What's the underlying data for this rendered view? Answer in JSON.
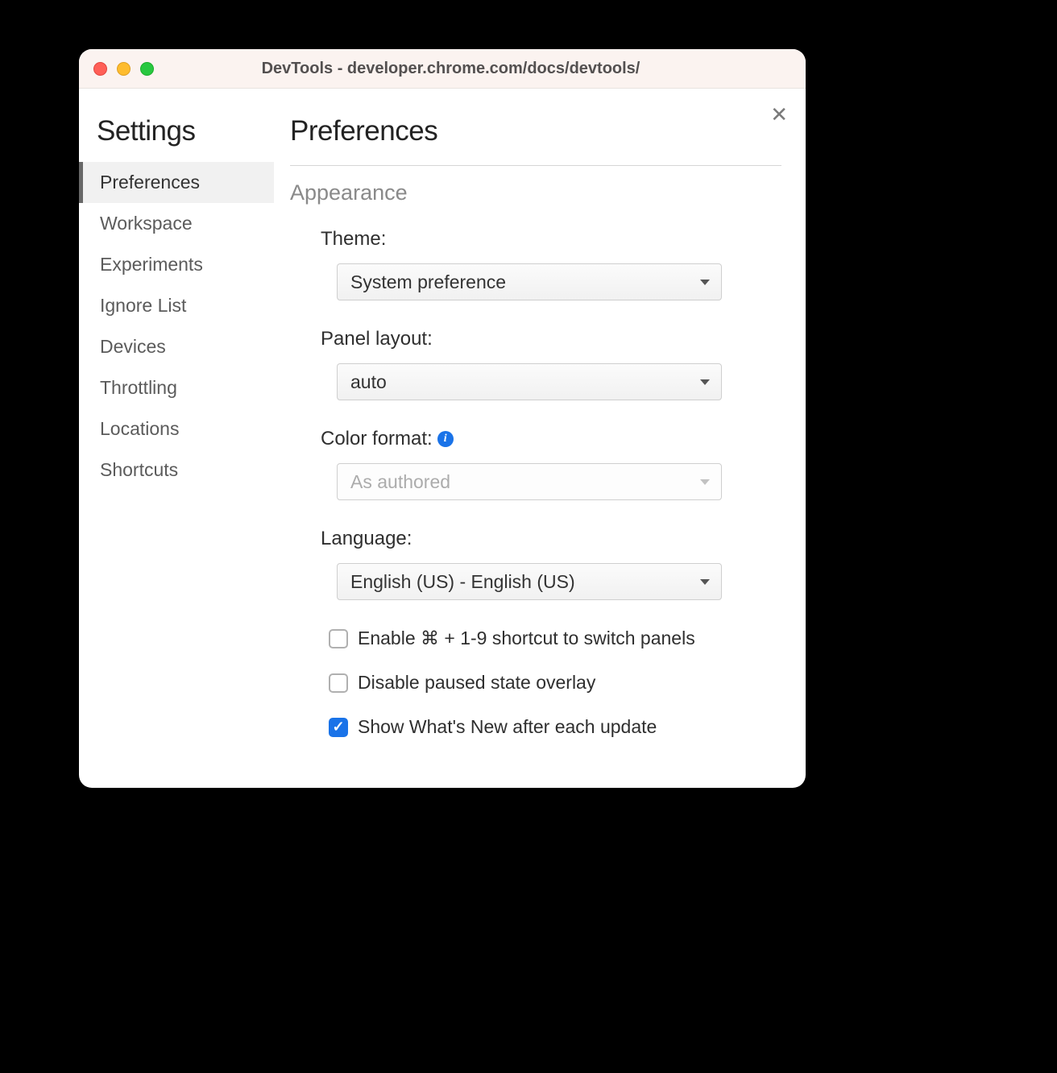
{
  "window": {
    "title": "DevTools - developer.chrome.com/docs/devtools/"
  },
  "sidebar": {
    "title": "Settings",
    "items": [
      {
        "label": "Preferences",
        "active": true
      },
      {
        "label": "Workspace",
        "active": false
      },
      {
        "label": "Experiments",
        "active": false
      },
      {
        "label": "Ignore List",
        "active": false
      },
      {
        "label": "Devices",
        "active": false
      },
      {
        "label": "Throttling",
        "active": false
      },
      {
        "label": "Locations",
        "active": false
      },
      {
        "label": "Shortcuts",
        "active": false
      }
    ]
  },
  "main": {
    "title": "Preferences",
    "section": "Appearance",
    "theme": {
      "label": "Theme:",
      "value": "System preference"
    },
    "panel_layout": {
      "label": "Panel layout:",
      "value": "auto"
    },
    "color_format": {
      "label": "Color format:",
      "value": "As authored",
      "disabled": true
    },
    "language": {
      "label": "Language:",
      "value": "English (US) - English (US)"
    },
    "checkboxes": [
      {
        "label": "Enable ⌘ + 1-9 shortcut to switch panels",
        "checked": false
      },
      {
        "label": "Disable paused state overlay",
        "checked": false
      },
      {
        "label": "Show What's New after each update",
        "checked": true
      }
    ]
  }
}
